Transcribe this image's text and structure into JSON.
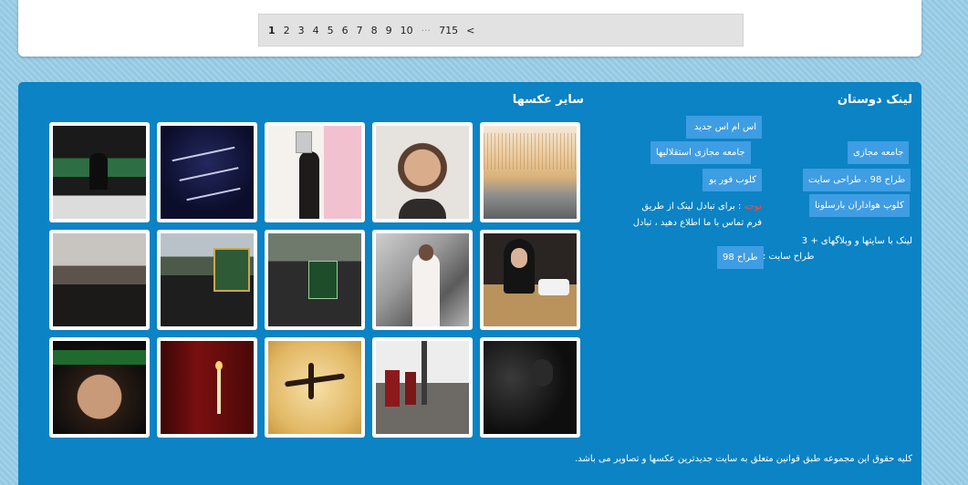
{
  "pagination": {
    "pages": [
      "1",
      "2",
      "3",
      "4",
      "5",
      "6",
      "7",
      "8",
      "9",
      "10"
    ],
    "current": "1",
    "ellipsis": "···",
    "last": "715",
    "next": "<"
  },
  "friends_links": {
    "title": "لینک دوستان",
    "col_right": [
      "جامعه مجازی",
      "طراح 98 ، طراحی سایت",
      "کلوپ هواداران بارسلونا"
    ],
    "col_left": [
      "اس ام اس جدید",
      "جامعه مجازی استقلالیها",
      "کلوب فور یو"
    ],
    "note_label": "توجه",
    "note_line1": " : برای تبادل لینک از طریق",
    "note_line2": "فرم تماس با ما اطلاع دهید ، تبادل",
    "note_line3": "لینک با سایتها و وبلاگهای + 3",
    "designer_label": "طراح سایت :",
    "designer_value": "طراح 98"
  },
  "gallery": {
    "title": "سایر عکسها",
    "thumbnails": [
      {
        "name": "photo-1",
        "desc": "noodles-factory"
      },
      {
        "name": "photo-2",
        "desc": "smiling-man"
      },
      {
        "name": "photo-3",
        "desc": "man-at-podium"
      },
      {
        "name": "photo-4",
        "desc": "calligraphy-night"
      },
      {
        "name": "photo-5",
        "desc": "mourning-ceremony"
      },
      {
        "name": "photo-6",
        "desc": "woman-serving-food"
      },
      {
        "name": "photo-7",
        "desc": "woman-graffiti"
      },
      {
        "name": "photo-8",
        "desc": "procession-banner"
      },
      {
        "name": "photo-9",
        "desc": "crowd-shrine"
      },
      {
        "name": "photo-10",
        "desc": "crowd-street"
      },
      {
        "name": "photo-11",
        "desc": "night-gathering"
      },
      {
        "name": "photo-12",
        "desc": "flags-procession"
      },
      {
        "name": "photo-13",
        "desc": "ashura-calligraphy"
      },
      {
        "name": "photo-14",
        "desc": "red-cloth-candle"
      },
      {
        "name": "photo-15",
        "desc": "child-green-headband"
      }
    ]
  },
  "footer": {
    "copyright": "کلیه حقوق این مجموعه طبق قوانین متعلق به سایت جدیدترین عکسها و تصاویر می باشد."
  },
  "colors": {
    "panel": "#0b83c4",
    "chip": "#3f9de3",
    "warn": "#ff4a3d"
  }
}
